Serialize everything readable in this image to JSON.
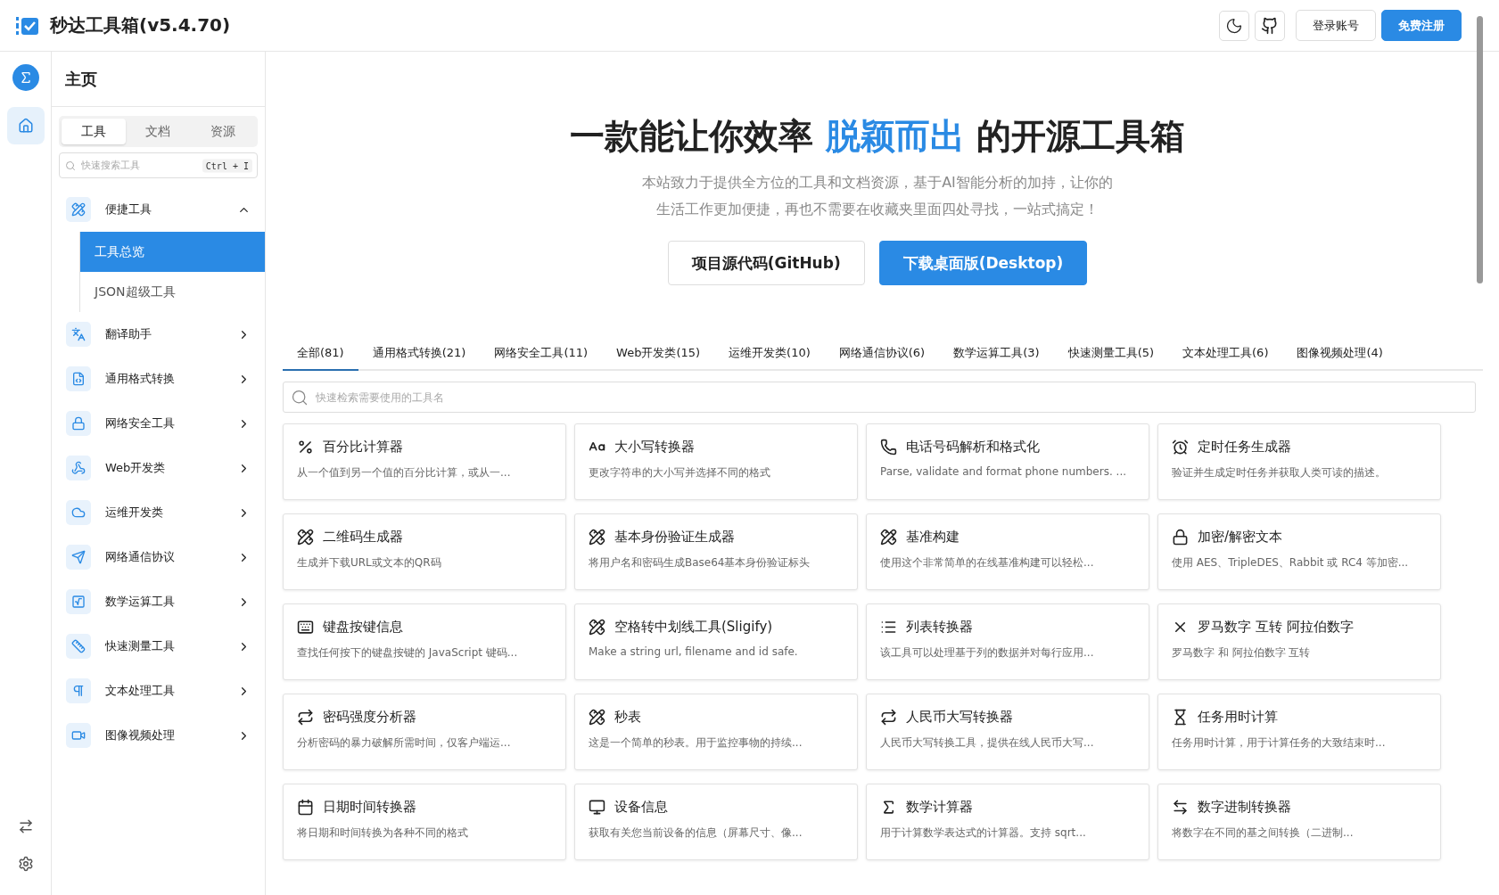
{
  "header": {
    "title": "秒达工具箱(v5.4.70)",
    "buttons": [
      {
        "label": "登录账号",
        "kind": "outline"
      },
      {
        "label": "免费注册",
        "kind": "primary"
      }
    ]
  },
  "sidebar": {
    "title": "主页",
    "tabs": [
      {
        "label": "工具",
        "selected": true
      },
      {
        "label": "文档",
        "selected": false
      },
      {
        "label": "资源",
        "selected": false
      }
    ],
    "search": {
      "placeholder": "快速搜索工具",
      "shortcut": "Ctrl + I"
    },
    "groups": [
      {
        "label": "便捷工具",
        "expanded": true,
        "children": [
          {
            "label": "工具总览",
            "selected": true
          },
          {
            "label": "JSON超级工具",
            "selected": false
          }
        ]
      },
      {
        "label": "翻译助手",
        "expanded": false
      },
      {
        "label": "通用格式转换",
        "expanded": false
      },
      {
        "label": "网络安全工具",
        "expanded": false
      },
      {
        "label": "Web开发类",
        "expanded": false
      },
      {
        "label": "运维开发类",
        "expanded": false
      },
      {
        "label": "网络通信协议",
        "expanded": false
      },
      {
        "label": "数学运算工具",
        "expanded": false
      },
      {
        "label": "快速测量工具",
        "expanded": false
      },
      {
        "label": "文本处理工具",
        "expanded": false
      },
      {
        "label": "图像视频处理",
        "expanded": false
      }
    ]
  },
  "hero": {
    "title_before": "一款能让你效率",
    "title_highlight": "脱颖而出",
    "title_after": "的开源工具箱",
    "subtitle_lines": [
      "本站致力于提供全方位的工具和文档资源，基于AI智能分析的加持，让你的",
      "生活工作更加便捷，再也不需要在收藏夹里面四处寻找，一站式搞定！"
    ],
    "buttons": [
      {
        "label": "项目源代码(GitHub)",
        "kind": "outline"
      },
      {
        "label": "下载桌面版(Desktop)",
        "kind": "primary"
      }
    ]
  },
  "category_tabs": [
    {
      "label": "全部(81)",
      "selected": true
    },
    {
      "label": "通用格式转换(21)",
      "selected": false
    },
    {
      "label": "网络安全工具(11)",
      "selected": false
    },
    {
      "label": "Web开发类(15)",
      "selected": false
    },
    {
      "label": "运维开发类(10)",
      "selected": false
    },
    {
      "label": "网络通信协议(6)",
      "selected": false
    },
    {
      "label": "数学运算工具(3)",
      "selected": false
    },
    {
      "label": "快速测量工具(5)",
      "selected": false
    },
    {
      "label": "文本处理工具(6)",
      "selected": false
    },
    {
      "label": "图像视频处理(4)",
      "selected": false
    }
  ],
  "tool_search": {
    "placeholder": "快速检索需要使用的工具名"
  },
  "tools": [
    {
      "title": "百分比计算器",
      "description": "从一个值到另一个值的百分比计算，或从一..."
    },
    {
      "title": "大小写转换器",
      "description": "更改字符串的大小写并选择不同的格式"
    },
    {
      "title": "电话号码解析和格式化",
      "description": "Parse, validate and format phone numbers. ..."
    },
    {
      "title": "定时任务生成器",
      "description": "验证并生成定时任务并获取人类可读的描述。"
    },
    {
      "title": "二维码生成器",
      "description": "生成并下载URL或文本的QR码"
    },
    {
      "title": "基本身份验证生成器",
      "description": "将用户名和密码生成Base64基本身份验证标头"
    },
    {
      "title": "基准构建",
      "description": "使用这个非常简单的在线基准构建可以轻松..."
    },
    {
      "title": "加密/解密文本",
      "description": "使用 AES、TripleDES、Rabbit 或 RC4 等加密..."
    },
    {
      "title": "键盘按键信息",
      "description": "查找任何按下的键盘按键的 JavaScript 键码..."
    },
    {
      "title": "空格转中划线工具(Sligify)",
      "description": "Make a string url, filename and id safe."
    },
    {
      "title": "列表转换器",
      "description": "该工具可以处理基于列的数据并对每行应用..."
    },
    {
      "title": "罗马数字 互转 阿拉伯数字",
      "description": "罗马数字 和 阿拉伯数字 互转"
    },
    {
      "title": "密码强度分析器",
      "description": "分析密码的暴力破解所需时间，仅客户端运..."
    },
    {
      "title": "秒表",
      "description": "这是一个简单的秒表。用于监控事物的持续..."
    },
    {
      "title": "人民币大写转换器",
      "description": "人民币大写转换工具，提供在线人民币大写..."
    },
    {
      "title": "任务用时计算",
      "description": "任务用时计算，用于计算任务的大致结束时..."
    },
    {
      "title": "日期时间转换器",
      "description": "将日期和时间转换为各种不同的格式"
    },
    {
      "title": "设备信息",
      "description": "获取有关您当前设备的信息（屏幕尺寸、像..."
    },
    {
      "title": "数学计算器",
      "description": "用于计算数学表达式的计算器。支持 sqrt..."
    },
    {
      "title": "数字进制转换器",
      "description": "将数字在不同的基之间转换（二进制..."
    }
  ]
}
